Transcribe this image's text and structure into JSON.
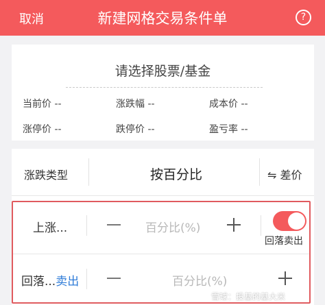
{
  "header": {
    "cancel": "取消",
    "title": "新建网格交易条件单",
    "help": "?"
  },
  "stock": {
    "placeholder": "请选择股票/基金",
    "current_price": "当前价 --",
    "change_pct": "涨跌幅 --",
    "cost_price": "成本价 --",
    "limit_up": "涨停价 --",
    "limit_down": "跌停价 --",
    "profit_ratio": "盈亏率 --"
  },
  "grid": {
    "type_label": "涨跌类型",
    "type_value": "按百分比",
    "diff_switch": "⇋ 差价",
    "rise": {
      "label": "上涨...",
      "placeholder": "百分比(%)"
    },
    "fallback": {
      "label": "回落...",
      "action": "卖出",
      "placeholder": "百分比(%)"
    },
    "toggle": {
      "on": true,
      "label": "回落卖出",
      "color": "#f45a5c"
    }
  },
  "watermark": "雪球：投基的基大米",
  "colors": {
    "header": "#f45a5c",
    "highlight": "#e05a5e",
    "link": "#2f7cd8"
  }
}
